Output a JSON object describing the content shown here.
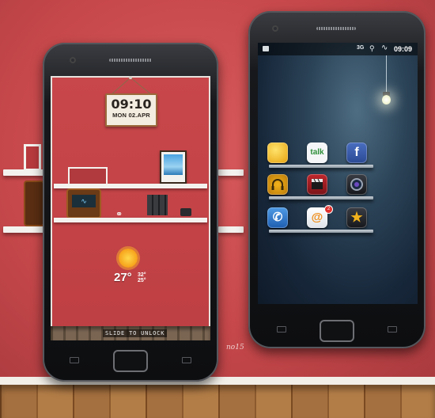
{
  "left_phone": {
    "lockscreen": {
      "clock": {
        "time": "09:10",
        "date": "MON 02.APR"
      },
      "weather": {
        "temperature": "27°",
        "high": "32°",
        "low": "25°"
      },
      "slide_label": "SLIDE TO UNLOCK"
    }
  },
  "right_phone": {
    "status_bar": {
      "network": "3G",
      "time": "09:09"
    },
    "apps": [
      {
        "icon": "messaging-icon",
        "label": "",
        "badge": ""
      },
      {
        "icon": "talk-icon",
        "label": "talk",
        "badge": ""
      },
      {
        "icon": "facebook-icon",
        "label": "f",
        "badge": ""
      },
      {
        "icon": "music-icon",
        "label": "",
        "badge": ""
      },
      {
        "icon": "video-icon",
        "label": "",
        "badge": ""
      },
      {
        "icon": "camera-icon",
        "label": "",
        "badge": ""
      },
      {
        "icon": "phone-icon",
        "label": "",
        "badge": ""
      },
      {
        "icon": "email-icon",
        "label": "@",
        "badge": "2"
      },
      {
        "icon": "favorites-icon",
        "label": "★",
        "badge": ""
      }
    ]
  },
  "watermark": "no15",
  "colors": {
    "wall": "#c94a4d",
    "screen_dark": "#17273a",
    "accent_gold": "#f6a11a"
  }
}
